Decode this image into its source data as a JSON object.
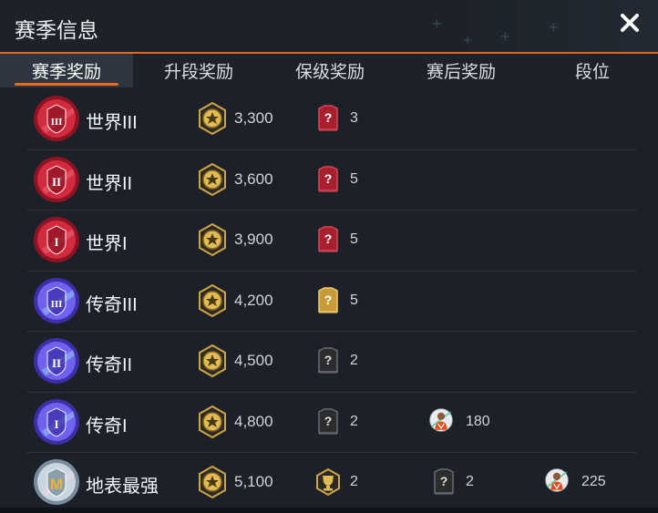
{
  "header": {
    "title": "赛季信息"
  },
  "tabs": [
    {
      "label": "赛季奖励",
      "active": true
    },
    {
      "label": "升段奖励",
      "active": false
    },
    {
      "label": "保级奖励",
      "active": false
    },
    {
      "label": "赛后奖励",
      "active": false
    },
    {
      "label": "段位",
      "active": false
    }
  ],
  "rows": [
    {
      "name": "世界III",
      "tier": "world",
      "roman": "III",
      "coins": "3,300",
      "pack": "red",
      "pack_count": "3"
    },
    {
      "name": "世界II",
      "tier": "world",
      "roman": "II",
      "coins": "3,600",
      "pack": "red",
      "pack_count": "5"
    },
    {
      "name": "世界I",
      "tier": "world",
      "roman": "I",
      "coins": "3,900",
      "pack": "red",
      "pack_count": "5"
    },
    {
      "name": "传奇III",
      "tier": "legend",
      "roman": "III",
      "coins": "4,200",
      "pack": "gold",
      "pack_count": "5"
    },
    {
      "name": "传奇II",
      "tier": "legend",
      "roman": "II",
      "coins": "4,500",
      "pack": "black",
      "pack_count": "2"
    },
    {
      "name": "传奇I",
      "tier": "legend",
      "roman": "I",
      "coins": "4,800",
      "pack": "black",
      "pack_count": "2",
      "player_count": "180"
    },
    {
      "name": "地表最强",
      "tier": "top",
      "roman": "",
      "coins": "5,100",
      "trophy_count": "2",
      "pack": "black",
      "pack_count": "2",
      "player_count": "225"
    }
  ],
  "colors": {
    "accent": "#e8691e",
    "world": "#c8243a",
    "legend": "#6b64e8",
    "gold": "#d8a93a"
  }
}
